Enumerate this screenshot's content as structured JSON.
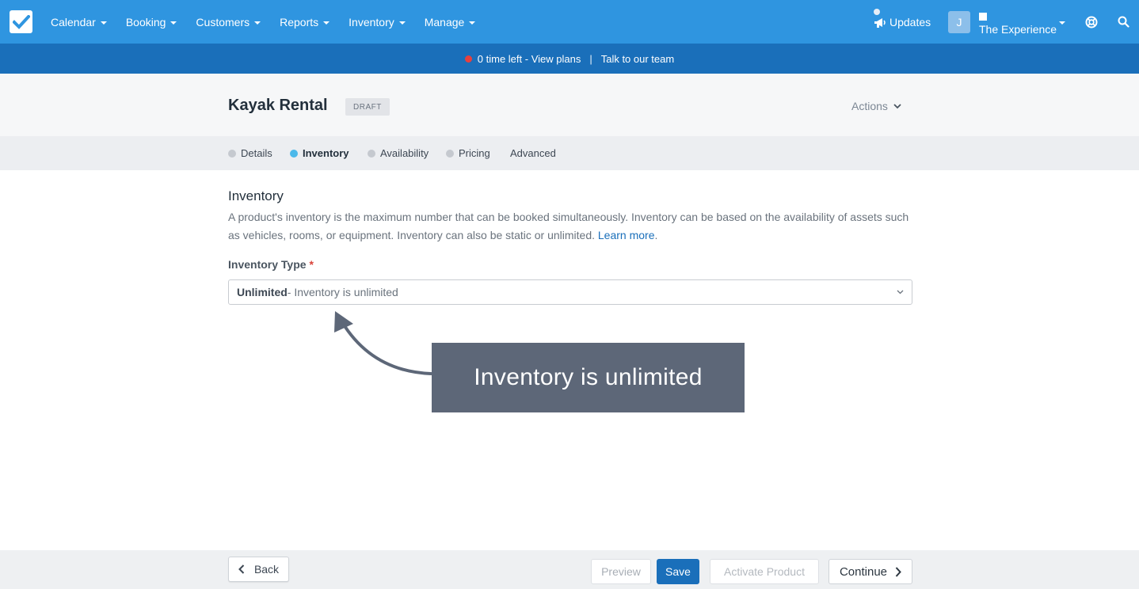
{
  "nav": {
    "items": [
      {
        "label": "Calendar"
      },
      {
        "label": "Booking"
      },
      {
        "label": "Customers"
      },
      {
        "label": "Reports"
      },
      {
        "label": "Inventory"
      },
      {
        "label": "Manage"
      }
    ],
    "updates_label": "Updates",
    "avatar_initial": "J",
    "account_name": "The Experience"
  },
  "banner": {
    "time_left": "0 time left - View plans",
    "separator": "|",
    "talk": "Talk to our team"
  },
  "header": {
    "title": "Kayak Rental",
    "badge": "DRAFT",
    "actions_label": "Actions"
  },
  "tabs": [
    {
      "label": "Details",
      "state": "incomplete"
    },
    {
      "label": "Inventory",
      "state": "active"
    },
    {
      "label": "Availability",
      "state": "incomplete"
    },
    {
      "label": "Pricing",
      "state": "incomplete"
    },
    {
      "label": "Advanced",
      "state": "none"
    }
  ],
  "content": {
    "section_title": "Inventory",
    "description": "A product's inventory is the maximum number that can be booked simultaneously. Inventory can be based on the availability of assets such as vehicles, rooms, or equipment. Inventory can also be static or unlimited.",
    "learn_more": "Learn more",
    "period": ".",
    "field_label": "Inventory Type",
    "required_mark": "*",
    "select_value_bold": "Unlimited",
    "select_value_rest": " - Inventory is unlimited"
  },
  "callout": {
    "text": "Inventory is unlimited"
  },
  "footer": {
    "back": "Back",
    "preview": "Preview",
    "save": "Save",
    "activate": "Activate Product",
    "continue": "Continue"
  },
  "colors": {
    "nav_bg": "#2f95e0",
    "banner_bg": "#1a6fba",
    "accent": "#1a6fba",
    "active_tab_dot": "#4cb9ea",
    "callout_bg": "#5d6778"
  }
}
